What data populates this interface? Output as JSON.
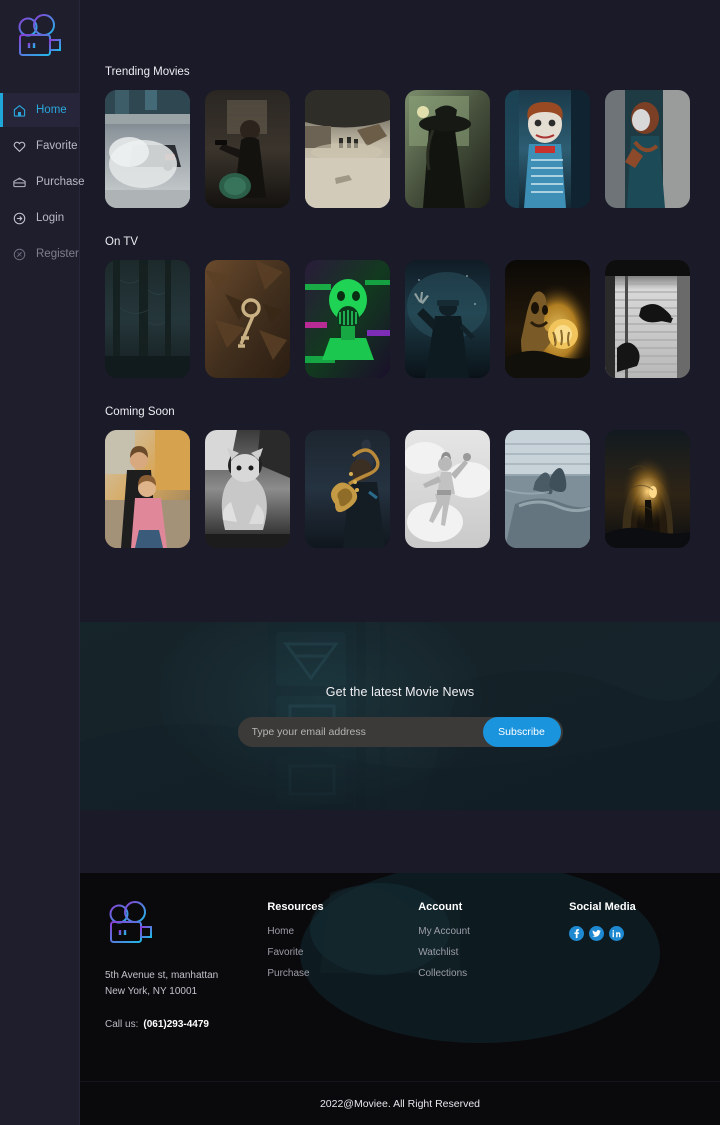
{
  "brand": {
    "logo_icon": "movie-camera-icon",
    "name": "Moviee"
  },
  "sidebar": {
    "items": [
      {
        "label": "Home",
        "icon": "home-icon",
        "active": true
      },
      {
        "label": "Favorite",
        "icon": "heart-icon",
        "active": false
      },
      {
        "label": "Purchase",
        "icon": "wallet-icon",
        "active": false
      },
      {
        "label": "Login",
        "icon": "login-icon",
        "active": false
      },
      {
        "label": "Register",
        "icon": "register-icon",
        "active": false
      }
    ]
  },
  "sections": [
    {
      "title": "Trending Movies",
      "cards": [
        {
          "name": "movie-card-smoke-car",
          "art": "smoke-car"
        },
        {
          "name": "movie-card-gunman",
          "art": "gunman"
        },
        {
          "name": "movie-card-street-chaos",
          "art": "street-chaos"
        },
        {
          "name": "movie-card-hat-woman",
          "art": "hat-woman"
        },
        {
          "name": "movie-card-doll",
          "art": "doll"
        },
        {
          "name": "movie-card-masked-figure",
          "art": "masked-figure"
        }
      ]
    },
    {
      "title": "On TV",
      "cards": [
        {
          "name": "tv-card-dark-forest",
          "art": "dark-forest"
        },
        {
          "name": "tv-card-rusty-key",
          "art": "rusty-key"
        },
        {
          "name": "tv-card-green-ghoul",
          "art": "green-ghoul"
        },
        {
          "name": "tv-card-night-figure",
          "art": "night-figure"
        },
        {
          "name": "tv-card-lantern",
          "art": "lantern"
        },
        {
          "name": "tv-card-blinds-hand",
          "art": "blinds-hand"
        }
      ]
    },
    {
      "title": "Coming Soon",
      "cards": [
        {
          "name": "soon-card-children",
          "art": "children"
        },
        {
          "name": "soon-card-cat",
          "art": "cat"
        },
        {
          "name": "soon-card-saxophone",
          "art": "saxophone"
        },
        {
          "name": "soon-card-dancer",
          "art": "dancer"
        },
        {
          "name": "soon-card-dolphins",
          "art": "dolphins"
        },
        {
          "name": "soon-card-cave",
          "art": "cave"
        }
      ]
    }
  ],
  "newsletter": {
    "title": "Get the latest Movie News",
    "placeholder": "Type your email address",
    "value": "",
    "button": "Subscribe",
    "button_color": "#1b94de"
  },
  "footer": {
    "address_line1": "5th Avenue st, manhattan",
    "address_line2": "New York, NY 10001",
    "call_label": "Call us:",
    "phone": "(061)293-4479",
    "columns": [
      {
        "heading": "Resources",
        "links": [
          "Home",
          "Favorite",
          "Purchase"
        ]
      },
      {
        "heading": "Account",
        "links": [
          "My Account",
          "Watchlist",
          "Collections"
        ]
      }
    ],
    "social_heading": "Social Media",
    "socials": [
      {
        "name": "facebook-icon",
        "label": "f"
      },
      {
        "name": "twitter-icon",
        "label": "t"
      },
      {
        "name": "linkedin-icon",
        "label": "in"
      }
    ],
    "copyright": "2022@Moviee. All Right Reserved"
  },
  "theme": {
    "background": "#1b1a28",
    "sidebar": "#1f1e2d",
    "accent": "#2aa8dd",
    "newsletter_bg": "#16242a",
    "footer_bg": "#0a0a0d"
  }
}
